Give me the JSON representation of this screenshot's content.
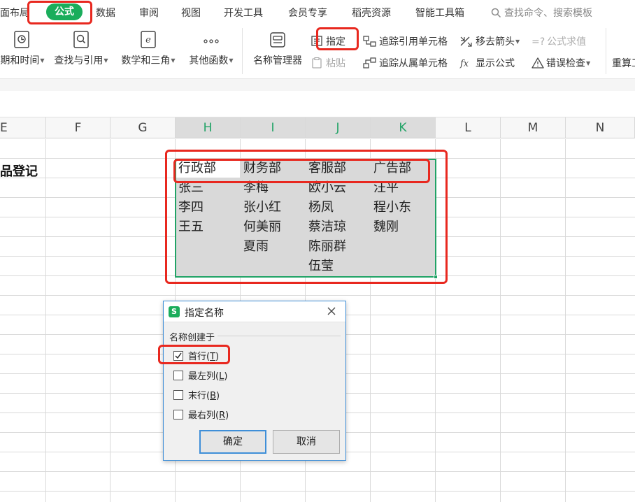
{
  "menu": {
    "items": [
      "面布局",
      "公式",
      "数据",
      "审阅",
      "视图",
      "开发工具",
      "会员专享",
      "稻壳资源",
      "智能工具箱"
    ],
    "active": "公式",
    "search_placeholder": "查找命令、搜索模板"
  },
  "ribbon": {
    "func_groups": [
      "期和时间",
      "查找与引用",
      "数学和三角",
      "其他函数"
    ],
    "name_manager": "名称管理器",
    "define": "指定",
    "paste": "粘贴",
    "trace_precedents": "追踪引用单元格",
    "trace_dependents": "追踪从属单元格",
    "remove_arrows": "移去箭头",
    "show_formulas": "显示公式",
    "evaluate_formula": "公式求值",
    "error_check": "错误检查",
    "recalc": "重算工"
  },
  "columns": [
    "E",
    "F",
    "G",
    "H",
    "I",
    "J",
    "K",
    "L",
    "M",
    "N"
  ],
  "selected_columns": [
    "H",
    "I",
    "J",
    "K"
  ],
  "sheet": {
    "title": "品登记",
    "headers": [
      "行政部",
      "财务部",
      "客服部",
      "广告部"
    ],
    "rows": [
      [
        "张三",
        "李梅",
        "欧小云",
        "汪平"
      ],
      [
        "李四",
        "张小红",
        "杨凤",
        "程小东"
      ],
      [
        "王五",
        "何美丽",
        "蔡洁琼",
        "魏刚"
      ],
      [
        "",
        "夏雨",
        "陈丽群",
        ""
      ],
      [
        "",
        "",
        "伍莹",
        ""
      ]
    ]
  },
  "dialog": {
    "title": "指定名称",
    "group_label": "名称创建于",
    "options": [
      {
        "label": "首行(",
        "key": "T",
        "checked": true
      },
      {
        "label": "最左列(",
        "key": "L",
        "checked": false
      },
      {
        "label": "末行(",
        "key": "B",
        "checked": false
      },
      {
        "label": "最右列(",
        "key": "R",
        "checked": false
      }
    ],
    "ok": "确定",
    "cancel": "取消"
  },
  "colors": {
    "accent_green": "#1aad5b",
    "selection_green": "#21a366",
    "annotation_red": "#e8281f",
    "dialog_border": "#3f8fd8"
  }
}
